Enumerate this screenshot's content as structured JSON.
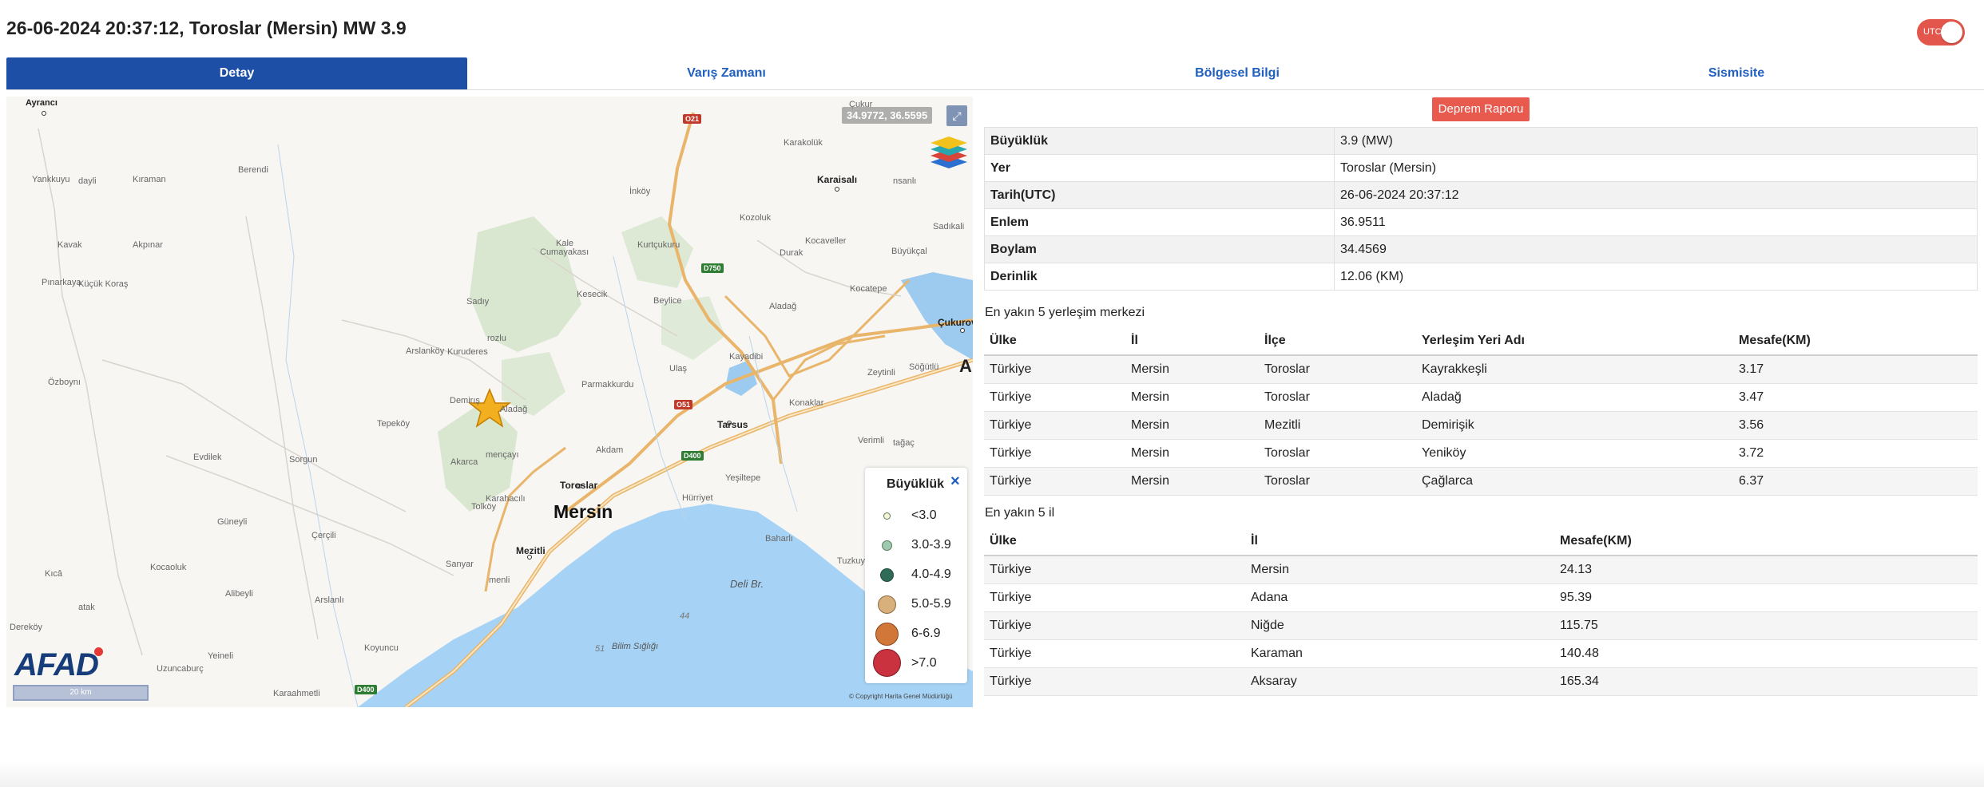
{
  "header": {
    "title": "26-06-2024 20:37:12, Toroslar (Mersin) MW 3.9",
    "utc_toggle_label": "UTC"
  },
  "tabs": [
    {
      "label": "Detay",
      "active": true
    },
    {
      "label": "Varış Zamanı",
      "active": false
    },
    {
      "label": "Bölgesel Bilgi",
      "active": false
    },
    {
      "label": "Sismisite",
      "active": false
    }
  ],
  "map": {
    "coordinates": "34.9772, 36.5595",
    "scale_label": "20 km",
    "brand": "AFAD",
    "copyright": "© Copyright Harita Genel Müdürlüğü",
    "big_city": "Mersin",
    "sea_label": "Deli Br.",
    "depth_44": "44",
    "depth_51": "51",
    "sea_place": "Bilim Sığlığı",
    "towns": {
      "karaisali": "Karaisalı",
      "tarsus": "Tarsus",
      "toroslar": "Toroslar",
      "mezitli": "Mezitli",
      "cukurova": "Çukurova"
    },
    "places": {
      "ayranci": "Ayrancı",
      "berendi": "Berendi",
      "yankkuyu": "Yankkuyu",
      "dayli": "dayli",
      "kiraman": "Kıraman",
      "kavak": "Kavak",
      "akpinar": "Akpınar",
      "pinarkaya": "Pınarkaya",
      "kucuk_koras": "Küçük Koraş",
      "sadiy": "Sadıy",
      "ozboyni": "Özboynı",
      "arslankoy": "Arslanköy",
      "kuruderes": "Kuruderes",
      "rozlu": "rozlu",
      "tepekoy": "Tepeköy",
      "demirisik": "Demirış",
      "aladag": "Aladağ",
      "evdilek": "Evdilek",
      "sorgun": "Sorgun",
      "akarca": "Akarca",
      "menecayi": "mençayı",
      "karahaci": "Karahacılı",
      "tolkoy": "Tolköy",
      "guneyli": "Güneyli",
      "cercili": "Çerçili",
      "sanyar": "Sanyar",
      "menli": "menli",
      "kocakoluk": "Kocaoluk",
      "alibeyli": "Alibeyli",
      "kica": "Kıcâ",
      "atak": "atak",
      "derekoy": "Dereköy",
      "arslanli": "Arslanlı",
      "koyuncu": "Koyuncu",
      "uzuncaburc": "Uzuncaburç",
      "yeineli": "Yeineli",
      "karaahmetli": "Karaahmetli",
      "kale": "Kale",
      "cumayakasi": "Cumayakası",
      "kurtcukuru": "Kurtçukuru",
      "inkoy": "İnköy",
      "kozoluk": "Kozoluk",
      "kesecik": "Kesecik",
      "beylice": "Beylice",
      "durak": "Durak",
      "kocaveller": "Kocaveller",
      "buyukcal": "Büyükçal",
      "kocatepe": "Kocatepe",
      "aladag2": "Aladağ",
      "sadikali": "Sadıkali",
      "karakoluk": "Karakolük",
      "cukur": "Çukur",
      "nsanli": "nsanlı",
      "kayadibi": "Kayadibi",
      "ulas": "Ulaş",
      "parmakkurdu": "Parmakkurdu",
      "zeytinli": "Zeytinli",
      "sogutlu": "Söğütlü",
      "konaklar": "Konaklar",
      "akdam": "Akdam",
      "huriyet": "Hürriyet",
      "yesiltepe": "Yeşiltepe",
      "verimli": "Verimli",
      "tagac": "tağaç",
      "baharli": "Baharlı",
      "tuzkuyusu": "Tuzkuyu",
      "a_label": "A"
    },
    "road_shields": {
      "o21": "O21",
      "d750": "D750",
      "o51": "O51",
      "d400": "D400",
      "d400b": "D400"
    },
    "legend": {
      "title": "Büyüklük",
      "close": "×",
      "items": [
        {
          "label": "<3.0",
          "color": "#f7f4d8"
        },
        {
          "label": "3.0-3.9",
          "color": "#9ec9b0"
        },
        {
          "label": "4.0-4.9",
          "color": "#2f6b57"
        },
        {
          "label": "5.0-5.9",
          "color": "#d8b07c"
        },
        {
          "label": "6-6.9",
          "color": "#d1773a"
        },
        {
          "label": ">7.0",
          "color": "#c9323e"
        }
      ]
    }
  },
  "report_button": "Deprem Raporu",
  "details": [
    {
      "key": "Büyüklük",
      "value": "3.9 (MW)"
    },
    {
      "key": "Yer",
      "value": "Toroslar (Mersin)"
    },
    {
      "key": "Tarih(UTC)",
      "value": "26-06-2024 20:37:12"
    },
    {
      "key": "Enlem",
      "value": "36.9511"
    },
    {
      "key": "Boylam",
      "value": "34.4569"
    },
    {
      "key": "Derinlik",
      "value": "12.06 (KM)"
    }
  ],
  "settlements": {
    "title": "En yakın 5 yerleşim merkezi",
    "headers": [
      "Ülke",
      "İl",
      "İlçe",
      "Yerleşim Yeri Adı",
      "Mesafe(KM)"
    ],
    "rows": [
      [
        "Türkiye",
        "Mersin",
        "Toroslar",
        "Kayrakkeşli",
        "3.17"
      ],
      [
        "Türkiye",
        "Mersin",
        "Toroslar",
        "Aladağ",
        "3.47"
      ],
      [
        "Türkiye",
        "Mersin",
        "Mezitli",
        "Demirişik",
        "3.56"
      ],
      [
        "Türkiye",
        "Mersin",
        "Toroslar",
        "Yeniköy",
        "3.72"
      ],
      [
        "Türkiye",
        "Mersin",
        "Toroslar",
        "Çağlarca",
        "6.37"
      ]
    ]
  },
  "provinces": {
    "title": "En yakın 5 il",
    "headers": [
      "Ülke",
      "İl",
      "Mesafe(KM)"
    ],
    "rows": [
      [
        "Türkiye",
        "Mersin",
        "24.13"
      ],
      [
        "Türkiye",
        "Adana",
        "95.39"
      ],
      [
        "Türkiye",
        "Niğde",
        "115.75"
      ],
      [
        "Türkiye",
        "Karaman",
        "140.48"
      ],
      [
        "Türkiye",
        "Aksaray",
        "165.34"
      ]
    ]
  }
}
